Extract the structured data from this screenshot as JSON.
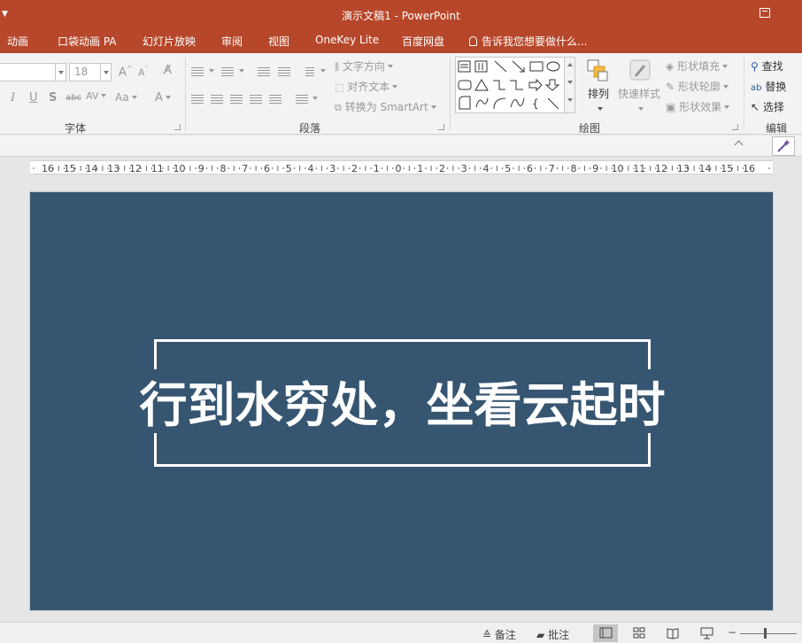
{
  "window": {
    "title": "演示文稿1 - PowerPoint"
  },
  "menu": {
    "tabs": [
      "动画",
      "口袋动画 PA",
      "幻灯片放映",
      "审阅",
      "视图",
      "OneKey Lite",
      "百度网盘"
    ],
    "tell_me": "告诉我您想要做什么..."
  },
  "ribbon": {
    "font": {
      "size_value": "18",
      "group_label": "字体"
    },
    "paragraph": {
      "text_direction": "文字方向",
      "align_text": "对齐文本",
      "convert_smartart": "转换为 SmartArt",
      "group_label": "段落"
    },
    "drawing": {
      "arrange_label": "排列",
      "quick_styles_label": "快速样式",
      "shape_fill": "形状填充",
      "shape_outline": "形状轮廓",
      "shape_effects": "形状效果",
      "group_label": "绘图"
    },
    "editing": {
      "find": "查找",
      "replace": "替换",
      "select": "选择",
      "group_label": "编辑"
    }
  },
  "ruler": {
    "labels": [
      "16",
      "15",
      "14",
      "13",
      "12",
      "11",
      "10",
      "9",
      "8",
      "7",
      "6",
      "5",
      "4",
      "3",
      "2",
      "1",
      "0",
      "1",
      "2",
      "3",
      "4",
      "5",
      "6",
      "7",
      "8",
      "9",
      "10",
      "11",
      "12",
      "13",
      "14",
      "15",
      "16"
    ]
  },
  "slide": {
    "background_color": "#365571",
    "text": "行到水穷处，坐看云起时"
  },
  "statusbar": {
    "notes": "备注",
    "comments": "批注"
  },
  "colors": {
    "accent": "#b7472a"
  }
}
